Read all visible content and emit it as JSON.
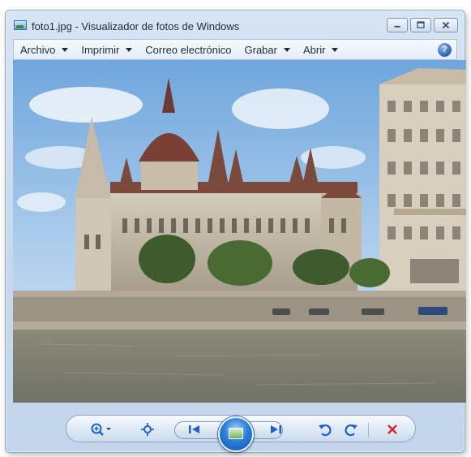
{
  "window": {
    "title": "foto1.jpg - Visualizador de fotos de Windows",
    "app_icon": "photo-viewer-icon"
  },
  "caption_buttons": {
    "minimize": "minimize-icon",
    "maximize": "maximize-icon",
    "close": "close-icon"
  },
  "menu": {
    "items": [
      {
        "label": "Archivo",
        "dropdown": true
      },
      {
        "label": "Imprimir",
        "dropdown": true
      },
      {
        "label": "Correo electrónico",
        "dropdown": false
      },
      {
        "label": "Grabar",
        "dropdown": true
      },
      {
        "label": "Abrir",
        "dropdown": true
      }
    ],
    "help_label": "?"
  },
  "photo": {
    "subject": "foto1.jpg"
  },
  "toolbar": {
    "buttons": [
      "zoom-icon",
      "actual-size-icon",
      "previous-icon",
      "slideshow-icon",
      "next-icon",
      "rotate-counterclockwise-icon",
      "rotate-clockwise-icon",
      "delete-icon"
    ],
    "delete_color": "#d0262c",
    "accent_color": "#1d63c4"
  }
}
